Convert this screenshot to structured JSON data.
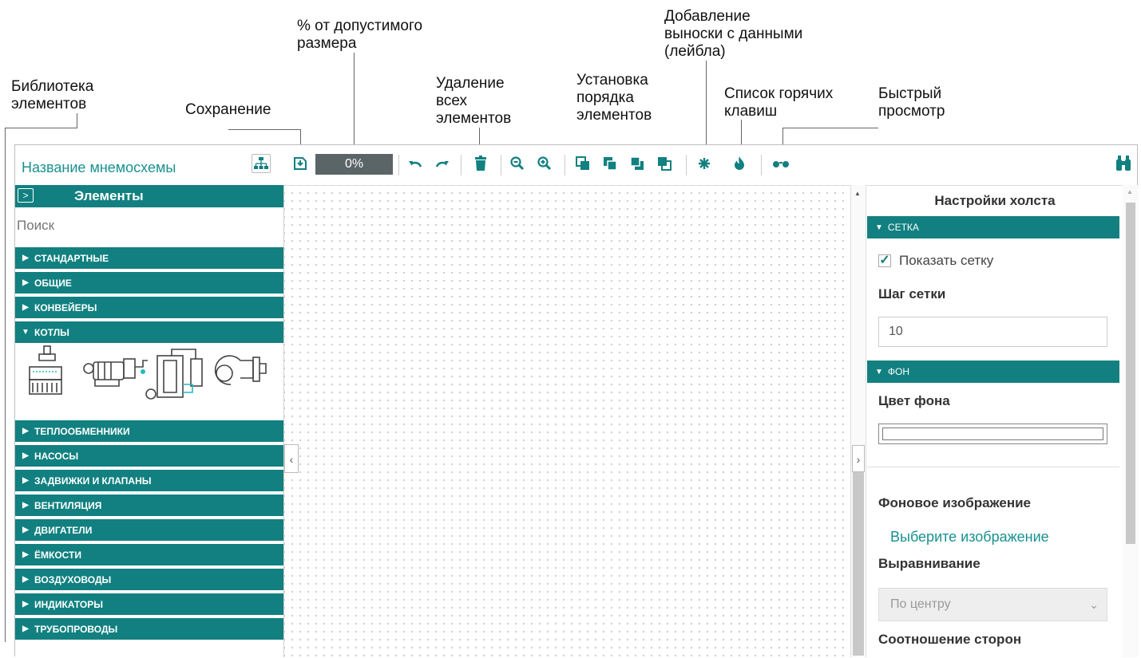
{
  "annotations": {
    "library": "Библиотека\nэлементов",
    "save": "Сохранение",
    "percent": "% от допустимого\nразмера",
    "delete_all": "Удаление\nвсех\nэлементов",
    "order": "Установка\nпорядка\nэлементов",
    "label": "Добавление\nвыноски с данными\n(лейбла)",
    "hotkeys": "Список горячих\nклавиш",
    "quick_view": "Быстрый\nпросмотр"
  },
  "header": {
    "scheme_name": "Название мнемосхемы",
    "size_percent": "0%"
  },
  "left_panel": {
    "expand_glyph": ">",
    "title": "Элементы",
    "search_placeholder": "Поиск",
    "categories": [
      "СТАНДАРТНЫЕ",
      "ОБЩИЕ",
      "КОНВЕЙЕРЫ",
      "КОТЛЫ",
      "ТЕПЛООБМЕННИКИ",
      "НАСОСЫ",
      "ЗАДВИЖКИ И КЛАПАНЫ",
      "ВЕНТИЛЯЦИЯ",
      "ДВИГАТЕЛИ",
      "ЁМКОСТИ",
      "ВОЗДУХОВОДЫ",
      "ИНДИКАТОРЫ",
      "ТРУБОПРОВОДЫ"
    ],
    "expanded_category": "КОТЛЫ"
  },
  "right_panel": {
    "title": "Настройки холста",
    "grid_section": "СЕТКА",
    "show_grid_label": "Показать сетку",
    "show_grid_checked": true,
    "grid_step_label": "Шаг сетки",
    "grid_step_value": "10",
    "bg_section": "ФОН",
    "bg_color_label": "Цвет фона",
    "bg_image_label": "Фоновое изображение",
    "choose_image_link": "Выберите изображение",
    "align_label": "Выравнивание",
    "align_value": "По центру",
    "aspect_label": "Соотношение сторон"
  },
  "colors": {
    "accent": "#128080",
    "link": "#1a9191",
    "size_bar": "#5b6466"
  },
  "icons": [
    "save-icon",
    "undo-icon",
    "redo-icon",
    "trash-icon",
    "zoom-out-icon",
    "zoom-in-icon",
    "bring-to-front-icon",
    "bring-forward-icon",
    "send-backward-icon",
    "send-to-back-icon",
    "label-callout-icon",
    "hotkeys-icon",
    "quick-view-icon",
    "binoculars-icon",
    "sitemap-icon"
  ]
}
